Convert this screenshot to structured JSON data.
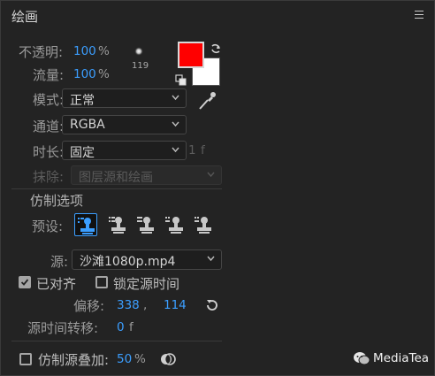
{
  "panel": {
    "title": "绘画",
    "menu_icon": "hamburger-menu-icon"
  },
  "opacity": {
    "label": "不透明:",
    "value": "100",
    "unit": "%"
  },
  "flow": {
    "label": "流量:",
    "value": "100",
    "unit": "%"
  },
  "brush": {
    "size": "119",
    "icon": "brush-tip-icon"
  },
  "colors": {
    "foreground": "#ff0000",
    "background": "#ffffff",
    "swap_icon": "swap-colors-icon",
    "reset_icon": "default-colors-icon",
    "eyedropper_icon": "eyedropper-icon"
  },
  "mode": {
    "label": "模式:",
    "value": "正常"
  },
  "channel": {
    "label": "通道:",
    "value": "RGBA"
  },
  "duration": {
    "label": "时长:",
    "value": "固定",
    "frames": "1",
    "frames_unit": "f"
  },
  "erase": {
    "label": "抹除:",
    "value": "图层源和绘画"
  },
  "clone_options": {
    "section_title": "仿制选项",
    "preset_label": "预设:",
    "presets": [
      "clone-preset-1-icon",
      "clone-preset-2-icon",
      "clone-preset-3-icon",
      "clone-preset-4-icon",
      "clone-preset-5-icon"
    ],
    "active_preset": 0,
    "source_label": "源:",
    "source_value": "沙滩1080p.mp4",
    "aligned": {
      "label": "已对齐",
      "checked": true
    },
    "lock_source_time": {
      "label": "锁定源时间",
      "checked": false
    },
    "offset": {
      "label": "偏移:",
      "x": "338",
      "sep": ",",
      "y": "114",
      "reset_icon": "reset-offset-icon"
    },
    "source_time_shift": {
      "label": "源时间转移:",
      "value": "0",
      "unit": "f"
    },
    "overlay": {
      "label": "仿制源叠加:",
      "checked": false,
      "value": "50",
      "unit": "%",
      "icon": "difference-mode-icon"
    }
  },
  "watermark": {
    "text": "MediaTea",
    "icon": "wechat-icon"
  },
  "accent_color": "#3b9eff"
}
